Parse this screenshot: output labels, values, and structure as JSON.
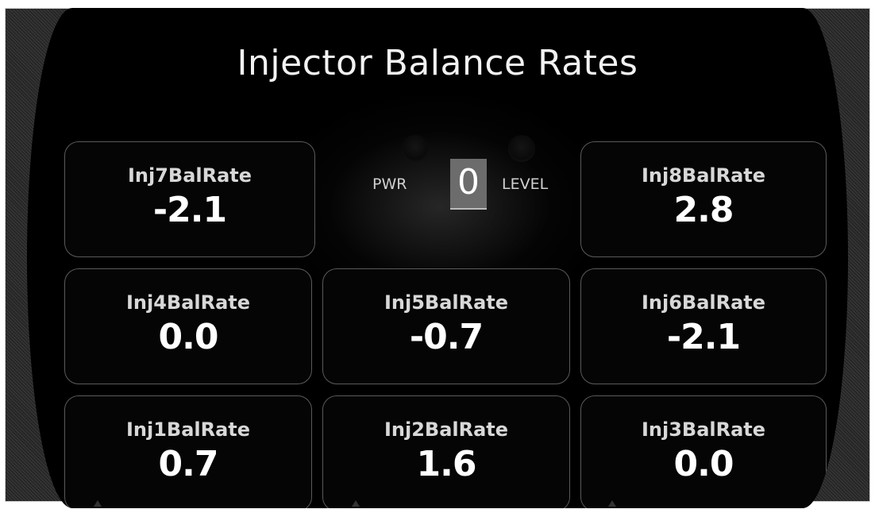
{
  "title": "Injector Balance Rates",
  "power_level": {
    "left_label": "PWR",
    "value": "0",
    "right_label": "LEVEL"
  },
  "tiles": [
    {
      "label": "Inj7BalRate",
      "value": "-2.1"
    },
    {
      "label": "Inj8BalRate",
      "value": "2.8"
    },
    {
      "label": "Inj4BalRate",
      "value": "0.0"
    },
    {
      "label": "Inj5BalRate",
      "value": "-0.7"
    },
    {
      "label": "Inj6BalRate",
      "value": "-2.1"
    },
    {
      "label": "Inj1BalRate",
      "value": "0.7"
    },
    {
      "label": "Inj2BalRate",
      "value": "1.6"
    },
    {
      "label": "Inj3BalRate",
      "value": "0.0"
    }
  ],
  "colors": {
    "background": "#000000",
    "text": "#ffffff",
    "tile_border": "#5a5a5a",
    "power_box": "#6c6c6c"
  }
}
